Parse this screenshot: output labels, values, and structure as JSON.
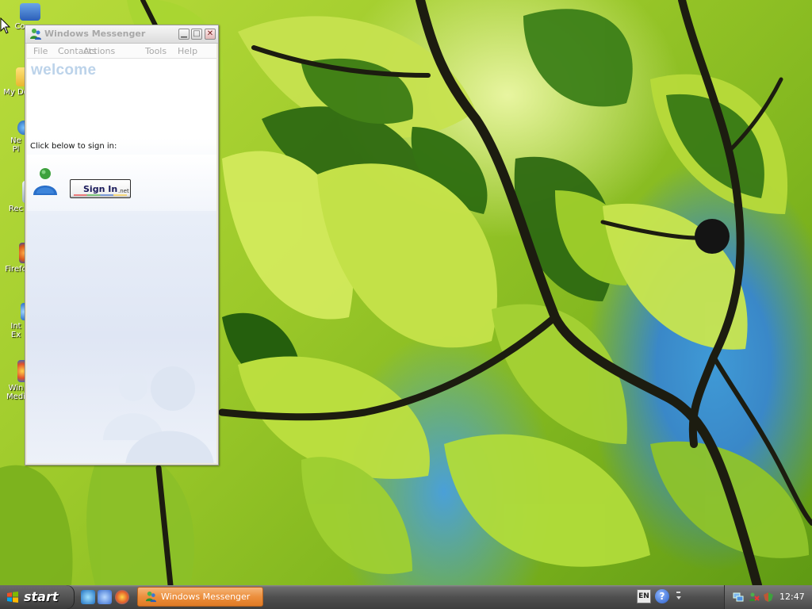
{
  "desktop": {
    "icons": [
      {
        "name": "my-computer",
        "label": "Co"
      },
      {
        "name": "my-documents",
        "label": "My Do"
      },
      {
        "name": "network",
        "label": "Ne\nPl"
      },
      {
        "name": "recycle-bin",
        "label": "Rec"
      },
      {
        "name": "firefox",
        "label": "Firefo"
      },
      {
        "name": "internet-explorer",
        "label": "Int\nEx"
      },
      {
        "name": "windows-media",
        "label": "Win\nMedi"
      }
    ]
  },
  "window": {
    "title": "Windows Messenger",
    "menu": [
      "File",
      "Contacts",
      "Actions",
      "Tools",
      "Help"
    ],
    "welcome": "welcome",
    "prompt": "Click below to sign in:",
    "sign_in_label": "Sign In",
    "sign_in_suffix": ".net"
  },
  "taskbar": {
    "start_label": "start",
    "task_label": "Windows Messenger",
    "language": "EN",
    "help": "?",
    "clock": "12:47"
  },
  "colors": {
    "task_active": "#ec8f3d",
    "welcome_text": "#bcd3ea",
    "taskbar": "#4f4f4f"
  }
}
